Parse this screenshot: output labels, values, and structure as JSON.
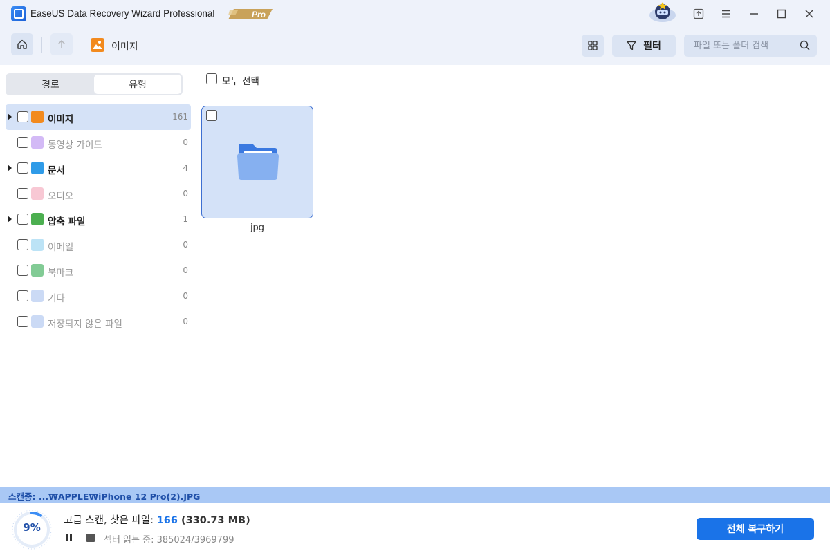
{
  "app": {
    "title": "EaseUS Data Recovery Wizard Professional",
    "badge": "Pro"
  },
  "toolbar": {
    "breadcrumb_label": "이미지",
    "filter_label": "필터",
    "search_placeholder": "파일 또는 폴더 검색"
  },
  "left_panel": {
    "tabs": [
      {
        "label": "경로",
        "active": false
      },
      {
        "label": "유형",
        "active": true
      }
    ],
    "items": [
      {
        "label": "이미지",
        "count": "161",
        "expandable": true,
        "selected": true,
        "icon": "image-icon",
        "color": "#f28a1e"
      },
      {
        "label": "동영상 가이드",
        "count": "0",
        "expandable": false,
        "selected": false,
        "icon": "video-icon",
        "color": "#b58cf0"
      },
      {
        "label": "문서",
        "count": "4",
        "expandable": true,
        "selected": false,
        "icon": "document-icon",
        "color": "#2f9be8"
      },
      {
        "label": "오디오",
        "count": "0",
        "expandable": false,
        "selected": false,
        "icon": "audio-icon",
        "color": "#f3a4b8"
      },
      {
        "label": "압축 파일",
        "count": "1",
        "expandable": true,
        "selected": false,
        "icon": "archive-icon",
        "color": "#4caf50"
      },
      {
        "label": "이메일",
        "count": "0",
        "expandable": false,
        "selected": false,
        "icon": "email-icon",
        "color": "#8fd0f0"
      },
      {
        "label": "북마크",
        "count": "0",
        "expandable": false,
        "selected": false,
        "icon": "bookmark-icon",
        "color": "#2fa84f"
      },
      {
        "label": "기타",
        "count": "0",
        "expandable": false,
        "selected": false,
        "icon": "other-icon",
        "color": "#a9c1ef"
      },
      {
        "label": "저장되지 않은 파일",
        "count": "0",
        "expandable": false,
        "selected": false,
        "icon": "unsaved-file-icon",
        "color": "#a9c1ef"
      }
    ]
  },
  "main": {
    "select_all_label": "모두 선택",
    "folders": [
      {
        "name": "jpg"
      }
    ]
  },
  "scan": {
    "current_path": "스캔중: ...₩APPLE₩iPhone 12 Pro(2).JPG",
    "percent_label": "9%",
    "progress_fraction": 0.09,
    "status_prefix": "고급 스캔, 찾은 파일: ",
    "found_count": "166",
    "found_size": " (330.73 MB)",
    "sector_label": "섹터 읽는 중: 385024/3969799"
  },
  "actions": {
    "recover_all_label": "전체 복구하기"
  },
  "colors": {
    "accent": "#1a73e8",
    "selection": "#d5e2f7",
    "titlebar_bg": "#eef2fa"
  }
}
